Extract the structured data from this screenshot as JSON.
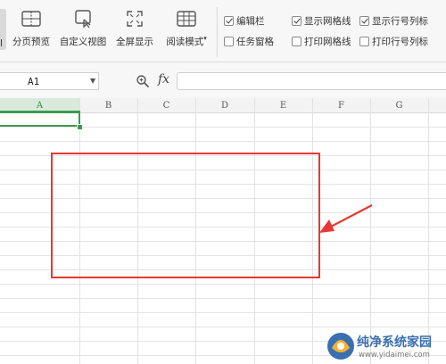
{
  "ribbon": {
    "left_partial_label": "l",
    "buttons": [
      {
        "icon": "page-break-preview-icon",
        "label": "分页预览"
      },
      {
        "icon": "custom-view-icon",
        "label": "自定义视图"
      },
      {
        "icon": "fullscreen-icon",
        "label": "全屏显示"
      },
      {
        "icon": "reading-mode-icon",
        "label": "阅读模式"
      }
    ],
    "checkboxes": [
      {
        "label": "编辑栏",
        "checked": true
      },
      {
        "label": "显示网格线",
        "checked": true
      },
      {
        "label": "显示行号列标",
        "checked": true
      },
      {
        "label": "任务窗格",
        "checked": false
      },
      {
        "label": "打印网格线",
        "checked": false
      },
      {
        "label": "打印行号列标",
        "checked": false
      }
    ]
  },
  "formula_bar": {
    "name_box": "A1",
    "zoom_icon": "magnifier-icon",
    "fx_label": "fx",
    "formula_value": ""
  },
  "sheet": {
    "columns": [
      "A",
      "B",
      "C",
      "D",
      "E",
      "F",
      "G"
    ],
    "selected_column": "A",
    "active_cell": "A1"
  },
  "annotation": {
    "box_color": "#e53935",
    "arrow_color": "#e53935"
  },
  "watermark": {
    "title": "纯净系统家园",
    "url": "www.yidaimei.com"
  },
  "colors": {
    "accent_green": "#3c9a50",
    "ribbon_bg": "#f7f7f7",
    "watermark_blue": "#3a6fb0"
  }
}
